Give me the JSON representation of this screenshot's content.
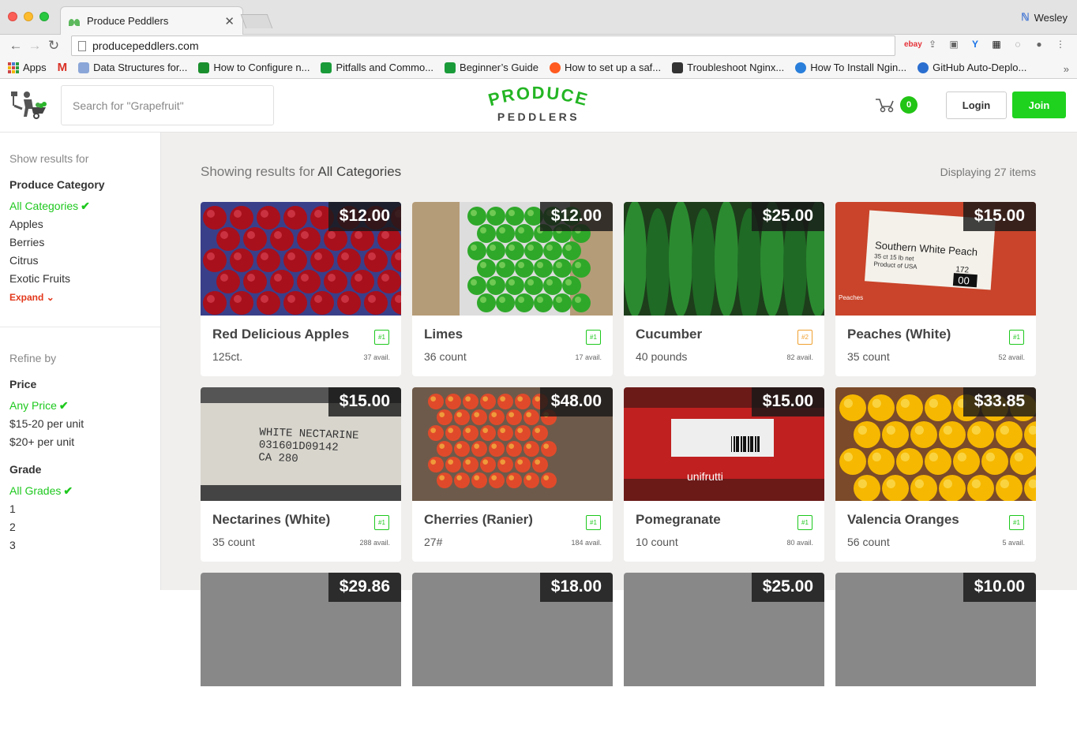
{
  "browser": {
    "tab_title": "Produce Peddlers",
    "profile_name": "Wesley",
    "url": "producepeddlers.com",
    "bookmarks": [
      {
        "label": "Apps",
        "icon": "apps-grid-icon",
        "color": "#c44"
      },
      {
        "label": "",
        "icon": "gmail-icon",
        "color": "#d93025"
      },
      {
        "label": "Data Structures for...",
        "icon": "book-icon",
        "color": "#8aa6d8"
      },
      {
        "label": "How to Configure n...",
        "icon": "cube-icon",
        "color": "#1a8f2e"
      },
      {
        "label": "Pitfalls and Commo...",
        "icon": "nginx-icon",
        "color": "#1a9b3a"
      },
      {
        "label": "Beginner’s Guide",
        "icon": "nginx-g-icon",
        "color": "#1a9b3a"
      },
      {
        "label": "How to set up a saf...",
        "icon": "ars-icon",
        "color": "#ff5a1f"
      },
      {
        "label": "Troubleshoot Nginx...",
        "icon": "shield-icon",
        "color": "#333"
      },
      {
        "label": "How To Install Ngin...",
        "icon": "do-icon",
        "color": "#2a7fdb"
      },
      {
        "label": "GitHub Auto-Deplo...",
        "icon": "circle-icon",
        "color": "#2a6fd0"
      }
    ]
  },
  "header": {
    "search_placeholder": "Search for \"Grapefruit\"",
    "brand_top": "PRODUCE",
    "brand_bottom": "PEDDLERS",
    "cart_count": "0",
    "login_label": "Login",
    "join_label": "Join"
  },
  "sidebar": {
    "show_results_for": "Show results for",
    "category_title": "Produce Category",
    "categories": [
      "All Categories",
      "Apples",
      "Berries",
      "Citrus",
      "Exotic Fruits"
    ],
    "expand_label": "Expand",
    "refine_by": "Refine by",
    "price_title": "Price",
    "prices": [
      "Any Price",
      "$15-20 per unit",
      "$20+ per unit"
    ],
    "grade_title": "Grade",
    "grades": [
      "All Grades",
      "1",
      "2",
      "3"
    ]
  },
  "results": {
    "prefix": "Showing results for ",
    "category": "All Categories",
    "count_label": "Displaying 27 items"
  },
  "products": [
    {
      "name": "Red Delicious Apples",
      "sub": "125ct.",
      "price": "$12.00",
      "grade": "#1",
      "avail": "37 avail.",
      "grade_color": "green",
      "img": "apples"
    },
    {
      "name": "Limes",
      "sub": "36 count",
      "price": "$12.00",
      "grade": "#1",
      "avail": "17 avail.",
      "grade_color": "green",
      "img": "limes"
    },
    {
      "name": "Cucumber",
      "sub": "40 pounds",
      "price": "$25.00",
      "grade": "#2",
      "avail": "82 avail.",
      "grade_color": "orange",
      "img": "cucumber"
    },
    {
      "name": "Peaches (White)",
      "sub": "35 count",
      "price": "$15.00",
      "grade": "#1",
      "avail": "52 avail.",
      "grade_color": "green",
      "img": "peach-box"
    },
    {
      "name": "Nectarines (White)",
      "sub": "35 count",
      "price": "$15.00",
      "grade": "#1",
      "avail": "288 avail.",
      "grade_color": "green",
      "img": "nectarine-box"
    },
    {
      "name": "Cherries (Ranier)",
      "sub": "27#",
      "price": "$48.00",
      "grade": "#1",
      "avail": "184 avail.",
      "grade_color": "green",
      "img": "cherries"
    },
    {
      "name": "Pomegranate",
      "sub": "10 count",
      "price": "$15.00",
      "grade": "#1",
      "avail": "80 avail.",
      "grade_color": "green",
      "img": "pomegranate"
    },
    {
      "name": "Valencia Oranges",
      "sub": "56 count",
      "price": "$33.85",
      "grade": "#1",
      "avail": "5 avail.",
      "grade_color": "green",
      "img": "oranges"
    },
    {
      "name": "",
      "sub": "",
      "price": "$29.86",
      "grade": "",
      "avail": "",
      "grade_color": "green",
      "img": "partial-1"
    },
    {
      "name": "",
      "sub": "",
      "price": "$18.00",
      "grade": "",
      "avail": "",
      "grade_color": "green",
      "img": "partial-2"
    },
    {
      "name": "",
      "sub": "",
      "price": "$25.00",
      "grade": "",
      "avail": "",
      "grade_color": "green",
      "img": "partial-3"
    },
    {
      "name": "",
      "sub": "",
      "price": "$10.00",
      "grade": "",
      "avail": "",
      "grade_color": "green",
      "img": "partial-4"
    }
  ],
  "image_text": {
    "peach_label_line1": "Southern White Peach",
    "peach_label_line2": "35 ct 15 lb net",
    "peach_label_line3": "Product of USA",
    "peach_label_num": "172",
    "peach_label_price": "00",
    "peach_side": "Peaches",
    "nectarine_line1": "WHITE NECTARINE",
    "nectarine_line2": "031601D09142",
    "nectarine_line3": "CA 280",
    "pomegranate_brand": "unifrutti"
  },
  "colors": {
    "accent_green": "#1ed21e",
    "expand_red": "#e2381b",
    "grade_orange": "#f0a030",
    "content_bg": "#f0efed"
  }
}
